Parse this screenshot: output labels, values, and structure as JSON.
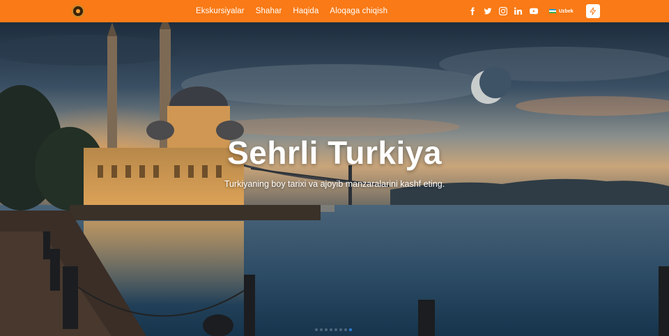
{
  "header": {
    "logo_icon": "logo-emblem-icon",
    "nav": [
      {
        "label": "Ekskursiyalar"
      },
      {
        "label": "Shahar"
      },
      {
        "label": "Haqida"
      },
      {
        "label": "Aloqaga chiqish"
      }
    ],
    "social": [
      "facebook-icon",
      "twitter-icon",
      "instagram-icon",
      "linkedin-icon",
      "youtube-icon"
    ],
    "language": {
      "label": "Uzbek",
      "flag": "uzbekistan-flag-icon"
    },
    "action_icon": "bolt-icon",
    "accent_color": "#f97a16"
  },
  "hero": {
    "title": "Sehrli Turkiya",
    "subtitle": "Turkiyaning boy tarixi va ajoyib manzaralarini kashf eting.",
    "slides_count": 8,
    "active_slide": 8
  }
}
